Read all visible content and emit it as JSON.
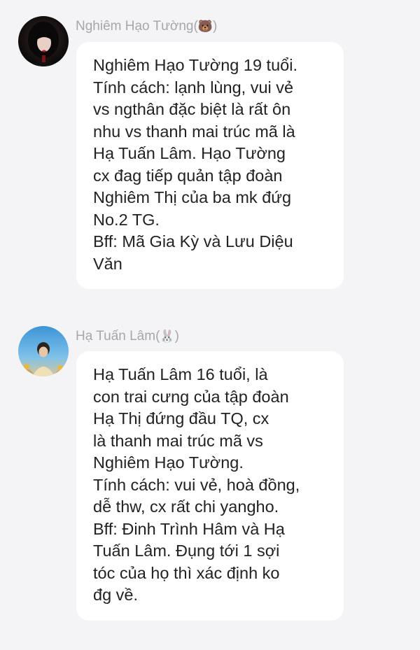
{
  "messages": [
    {
      "sender": {
        "name": "Nghiêm Hạo Tường(",
        "emoji": "🐻",
        "suffix": ")",
        "emoji_icon": "bear-face-icon"
      },
      "avatar": "avatar-dark-hair",
      "text_lines": [
        "Nghiêm Hạo Tường 19 tuổi.",
        "Tính cách: lạnh lùng, vui vẻ",
        "vs ngthân đặc biệt là rất ôn",
        "nhu vs thanh mai trúc mã là",
        "Hạ Tuấn Lâm. Hạo Tường",
        "cx đag tiếp quản tập đoàn",
        "Nghiêm Thị của ba mk đứg",
        "No.2 TG.",
        "Bff: Mã Gia Kỳ và Lưu Diệu",
        "Văn"
      ]
    },
    {
      "sender": {
        "name": "Hạ Tuấn Lâm(",
        "emoji": "🐰",
        "suffix": ")",
        "emoji_icon": "rabbit-face-icon"
      },
      "avatar": "avatar-blue-sky",
      "text_lines": [
        "Hạ Tuấn Lâm 16 tuổi, là",
        "con trai cưng của tập đoàn",
        "Hạ Thị đứng đầu TQ, cx",
        "là thanh mai trúc mã vs",
        "Nghiêm Hạo Tường.",
        "Tính cách: vui vẻ, hoà đồng,",
        "dễ thw, cx rất chi yangho.",
        "Bff: Đinh Trình Hâm và Hạ",
        "Tuấn Lâm. Đụng tới 1 sợi",
        "tóc của họ thì xác định ko",
        "đg về."
      ]
    }
  ]
}
